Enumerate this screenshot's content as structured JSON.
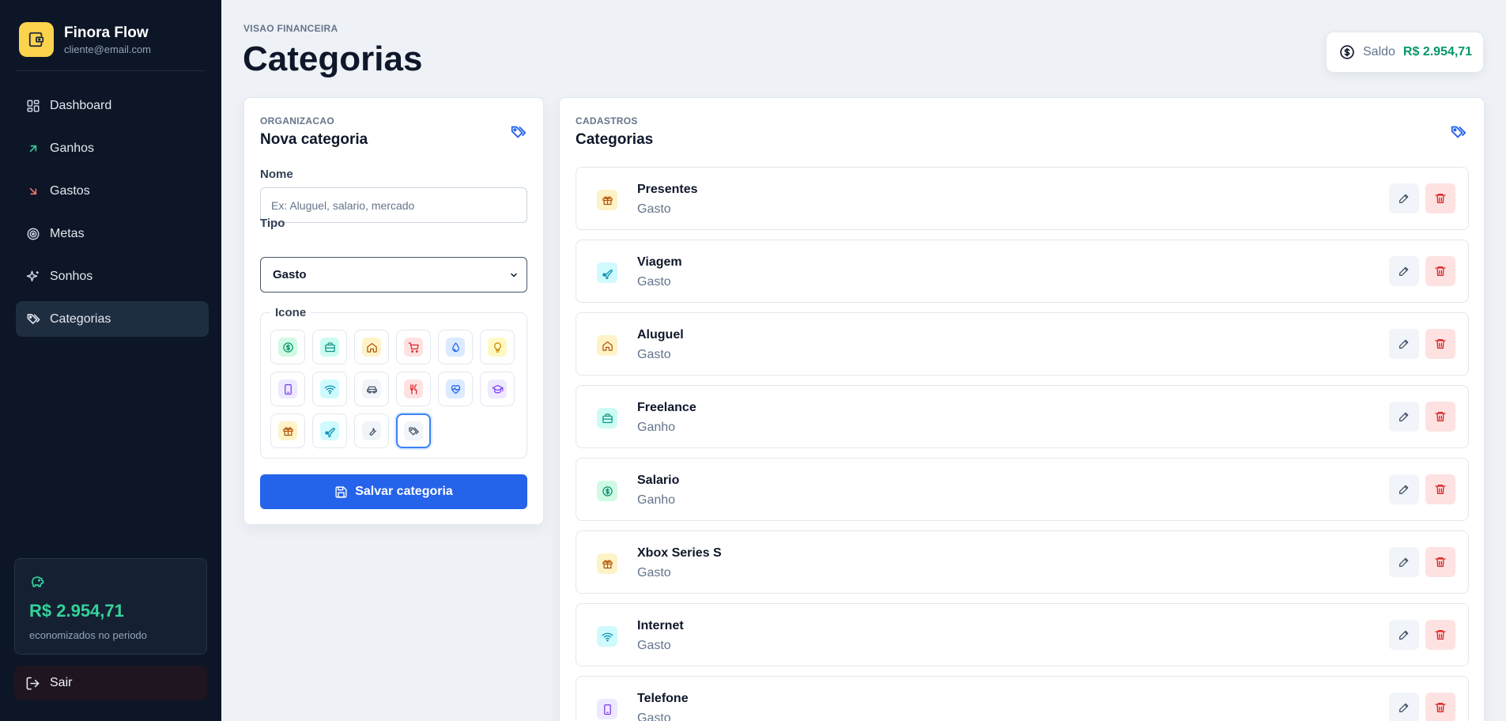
{
  "app": {
    "name": "Finora Flow",
    "email": "cliente@email.com"
  },
  "nav": [
    {
      "label": "Dashboard",
      "icon": "dashboard-icon",
      "active": false
    },
    {
      "label": "Ganhos",
      "icon": "arrow-up-right-icon",
      "active": false
    },
    {
      "label": "Gastos",
      "icon": "arrow-down-right-icon",
      "active": false
    },
    {
      "label": "Metas",
      "icon": "target-icon",
      "active": false
    },
    {
      "label": "Sonhos",
      "icon": "sparkles-icon",
      "active": false
    },
    {
      "label": "Categorias",
      "icon": "tags-icon",
      "active": true
    }
  ],
  "savings": {
    "amount": "R$ 2.954,71",
    "label": "economizados no periodo"
  },
  "logout_label": "Sair",
  "header": {
    "eyebrow": "VISAO FINANCEIRA",
    "title": "Categorias",
    "balance_label": "Saldo",
    "balance_value": "R$ 2.954,71"
  },
  "form": {
    "eyebrow": "ORGANIZACAO",
    "title": "Nova categoria",
    "name_label": "Nome",
    "name_value": "",
    "name_placeholder": "Ex: Aluguel, salario, mercado",
    "type_label": "Tipo",
    "type_value": "Gasto",
    "icon_legend": "Icone",
    "icons": [
      {
        "name": "dollar-icon",
        "bg": "#d1fae5",
        "fg": "#059669"
      },
      {
        "name": "briefcase-icon",
        "bg": "#ccfbf1",
        "fg": "#0d9488"
      },
      {
        "name": "home-icon",
        "bg": "#fef3c7",
        "fg": "#b45309"
      },
      {
        "name": "cart-icon",
        "bg": "#fee2e2",
        "fg": "#dc2626"
      },
      {
        "name": "droplet-icon",
        "bg": "#dbeafe",
        "fg": "#2563eb"
      },
      {
        "name": "lightbulb-icon",
        "bg": "#fef9c3",
        "fg": "#ca8a04"
      },
      {
        "name": "smartphone-icon",
        "bg": "#ede9fe",
        "fg": "#7c3aed"
      },
      {
        "name": "wifi-icon",
        "bg": "#cffafe",
        "fg": "#0891b2"
      },
      {
        "name": "car-icon",
        "bg": "#f1f5f9",
        "fg": "#475569"
      },
      {
        "name": "utensils-icon",
        "bg": "#fee2e2",
        "fg": "#dc2626"
      },
      {
        "name": "heart-pulse-icon",
        "bg": "#dbeafe",
        "fg": "#2563eb"
      },
      {
        "name": "graduation-cap-icon",
        "bg": "#ede9fe",
        "fg": "#7c3aed"
      },
      {
        "name": "gift-icon",
        "bg": "#fef3c7",
        "fg": "#b45309"
      },
      {
        "name": "plane-icon",
        "bg": "#cffafe",
        "fg": "#0891b2"
      },
      {
        "name": "wrench-icon",
        "bg": "#f1f5f9",
        "fg": "#475569"
      },
      {
        "name": "tag-icon",
        "bg": "#f1f5f9",
        "fg": "#475569",
        "selected": true
      }
    ],
    "save_label": "Salvar categoria"
  },
  "list": {
    "eyebrow": "CADASTROS",
    "title": "Categorias",
    "items": [
      {
        "name": "Presentes",
        "type": "Gasto",
        "icon": "gift-icon",
        "bg": "#fef3c7",
        "fg": "#b45309"
      },
      {
        "name": "Viagem",
        "type": "Gasto",
        "icon": "plane-icon",
        "bg": "#cffafe",
        "fg": "#0891b2"
      },
      {
        "name": "Aluguel",
        "type": "Gasto",
        "icon": "home-icon",
        "bg": "#fef3c7",
        "fg": "#b45309"
      },
      {
        "name": "Freelance",
        "type": "Ganho",
        "icon": "briefcase-icon",
        "bg": "#ccfbf1",
        "fg": "#0d9488"
      },
      {
        "name": "Salario",
        "type": "Ganho",
        "icon": "dollar-icon",
        "bg": "#d1fae5",
        "fg": "#059669"
      },
      {
        "name": "Xbox Series S",
        "type": "Gasto",
        "icon": "gift-icon",
        "bg": "#fef3c7",
        "fg": "#b45309"
      },
      {
        "name": "Internet",
        "type": "Gasto",
        "icon": "wifi-icon",
        "bg": "#cffafe",
        "fg": "#0891b2"
      },
      {
        "name": "Telefone",
        "type": "Gasto",
        "icon": "smartphone-icon",
        "bg": "#ede9fe",
        "fg": "#7c3aed"
      }
    ]
  },
  "colors": {
    "sidebar": "#0d1626",
    "accent": "#2563eb",
    "success": "#059669",
    "danger": "#dc2626"
  }
}
